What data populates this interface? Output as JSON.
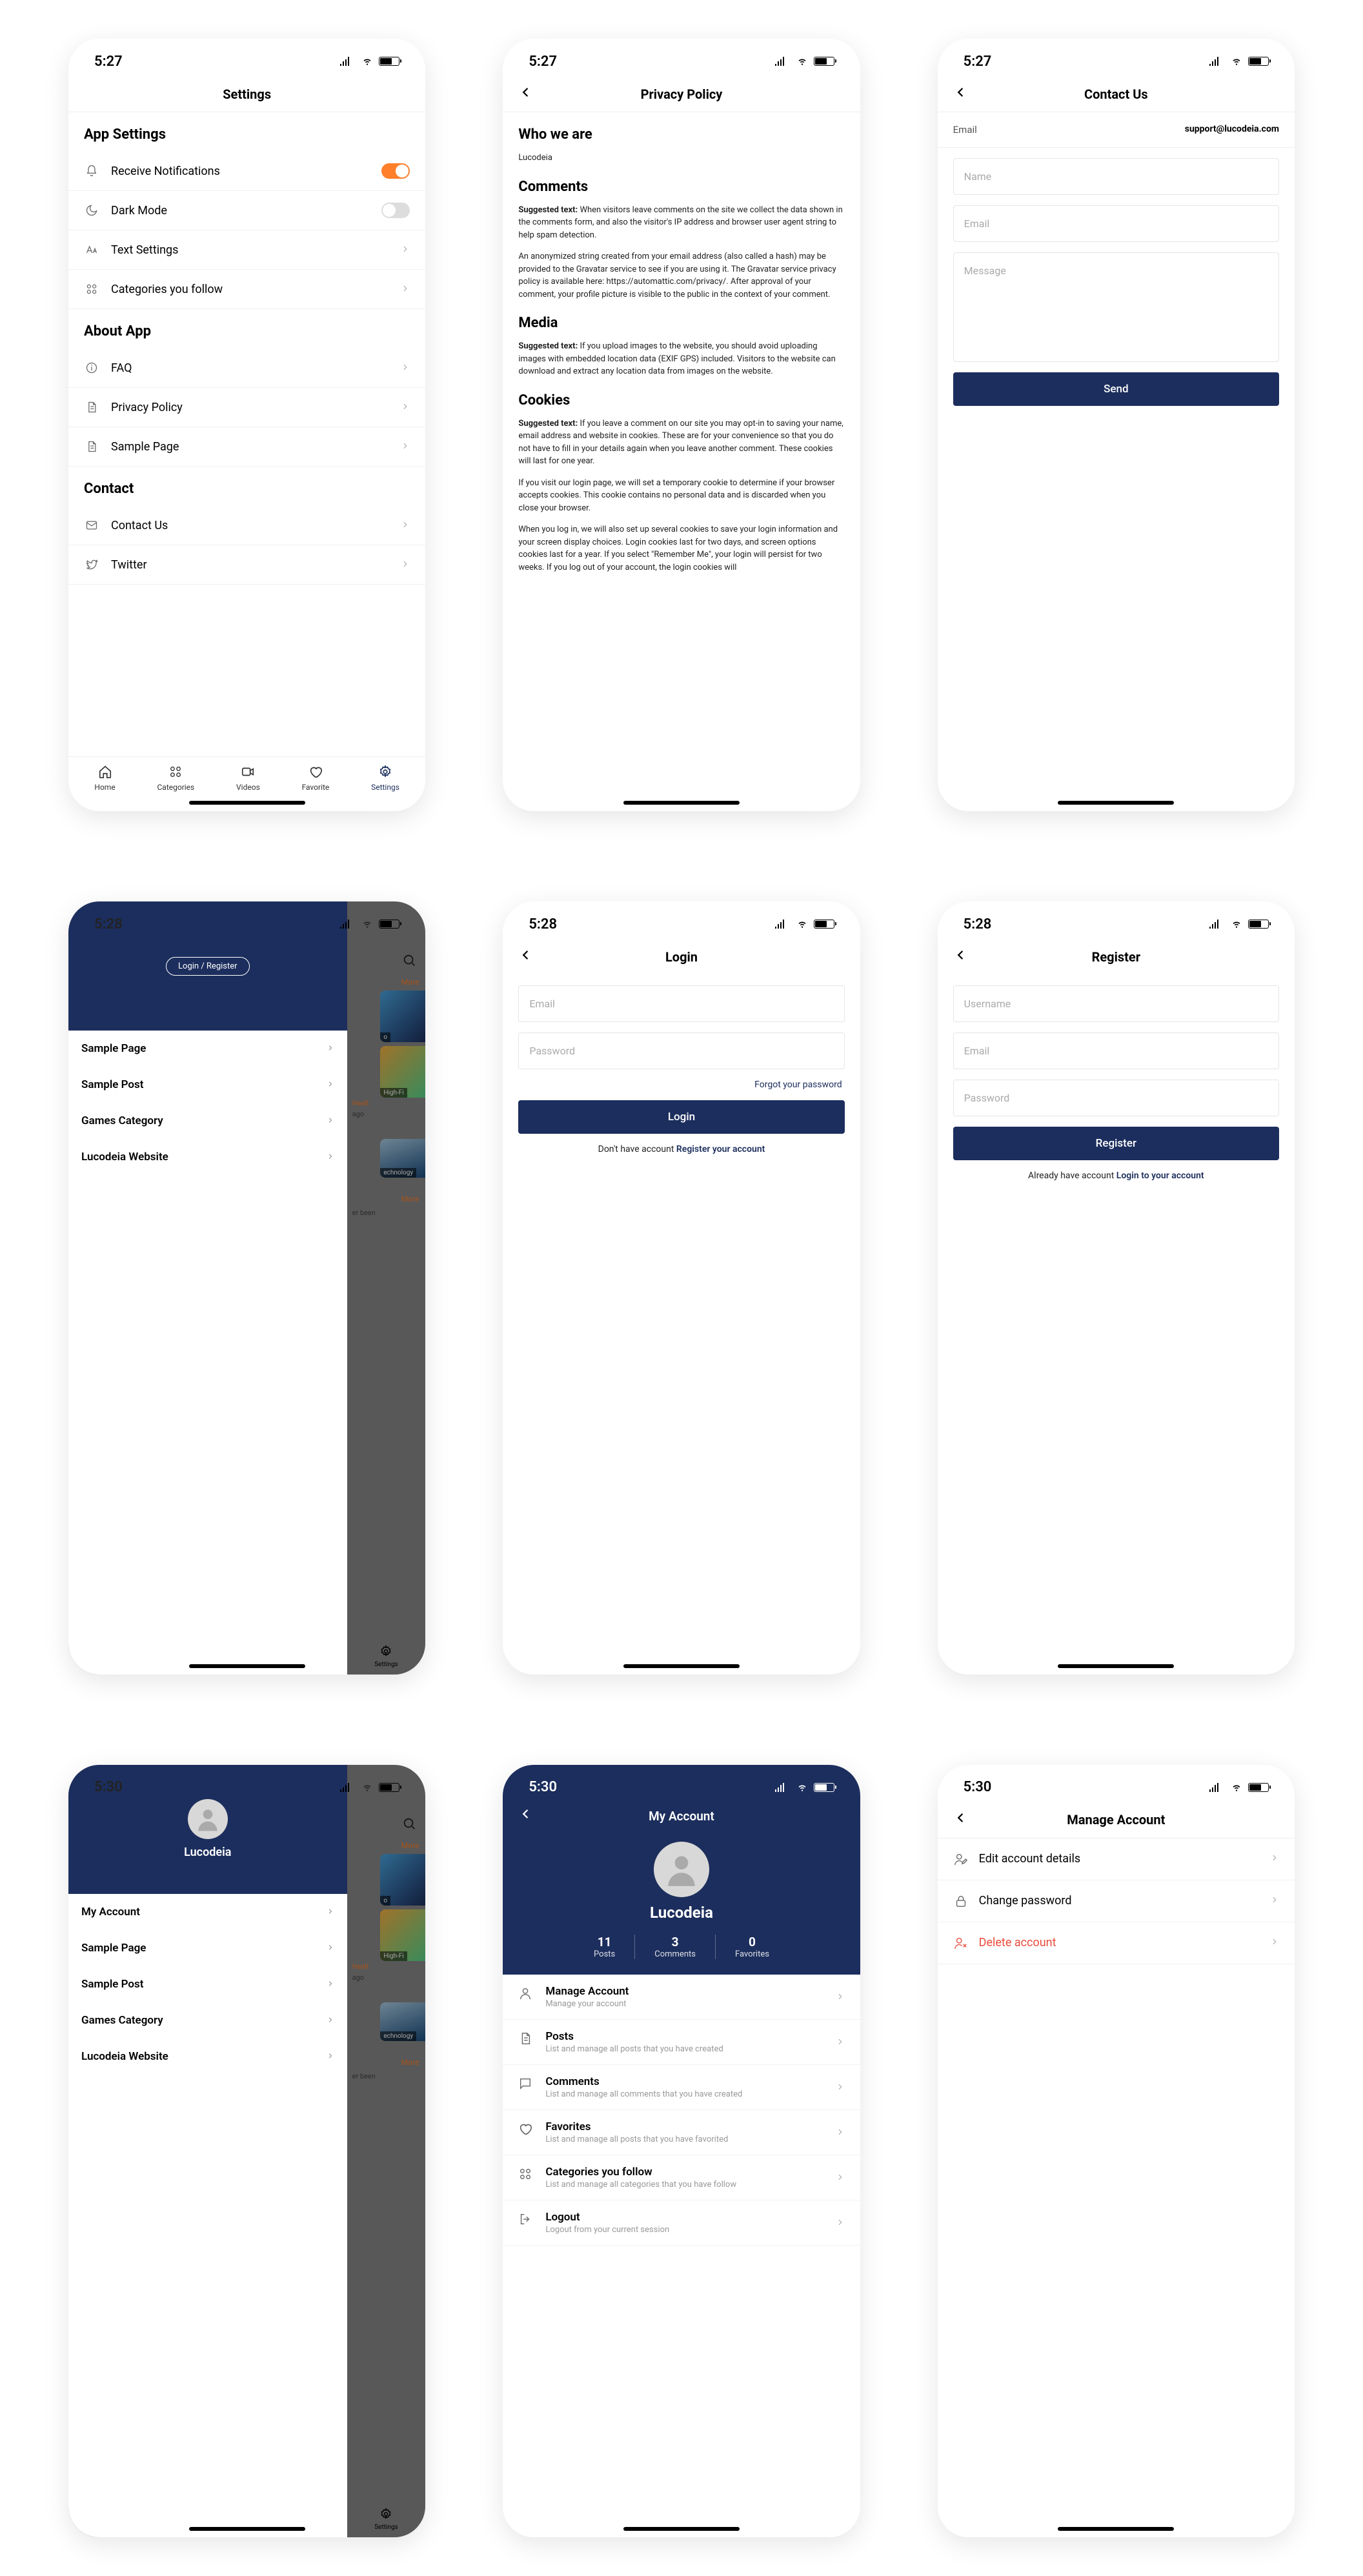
{
  "status_times": [
    "5:27",
    "5:27",
    "5:27",
    "5:28",
    "5:28",
    "5:28",
    "5:30",
    "5:30",
    "5:30"
  ],
  "screen1": {
    "title": "Settings",
    "sections": {
      "app": {
        "title": "App Settings",
        "items": [
          {
            "icon": "bell",
            "label": "Receive Notifications",
            "tail": "toggle-on"
          },
          {
            "icon": "moon",
            "label": "Dark Mode",
            "tail": "toggle-off"
          },
          {
            "icon": "text",
            "label": "Text Settings",
            "tail": "chevron"
          },
          {
            "icon": "grid",
            "label": "Categories you follow",
            "tail": "chevron"
          }
        ]
      },
      "about": {
        "title": "About App",
        "items": [
          {
            "icon": "info",
            "label": "FAQ",
            "tail": "chevron"
          },
          {
            "icon": "doc",
            "label": "Privacy Policy",
            "tail": "chevron"
          },
          {
            "icon": "doc",
            "label": "Sample Page",
            "tail": "chevron"
          }
        ]
      },
      "contact": {
        "title": "Contact",
        "items": [
          {
            "icon": "mail",
            "label": "Contact Us",
            "tail": "chevron"
          },
          {
            "icon": "twitter",
            "label": "Twitter",
            "tail": "chevron"
          }
        ]
      }
    },
    "tabs": [
      {
        "icon": "home",
        "label": "Home"
      },
      {
        "icon": "grid",
        "label": "Categories"
      },
      {
        "icon": "video",
        "label": "Videos"
      },
      {
        "icon": "heart",
        "label": "Favorite"
      },
      {
        "icon": "gear",
        "label": "Settings"
      }
    ]
  },
  "screen2": {
    "title": "Privacy Policy",
    "h_who": "Who we are",
    "p_who": "Lucodeia",
    "h_comments": "Comments",
    "p_c1_strong": "Suggested text:",
    "p_c1": " When visitors leave comments on the site we collect the data shown in the comments form, and also the visitor's IP address and browser user agent string to help spam detection.",
    "p_c2": "An anonymized string created from your email address (also called a hash) may be provided to the Gravatar service to see if you are using it. The Gravatar service privacy policy is available here: https://automattic.com/privacy/. After approval of your comment, your profile picture is visible to the public in the context of your comment.",
    "h_media": "Media",
    "p_m_strong": "Suggested text:",
    "p_m": " If you upload images to the website, you should avoid uploading images with embedded location data (EXIF GPS) included. Visitors to the website can download and extract any location data from images on the website.",
    "h_cookies": "Cookies",
    "p_ck1_strong": "Suggested text:",
    "p_ck1": " If you leave a comment on our site you may opt-in to saving your name, email address and website in cookies. These are for your convenience so that you do not have to fill in your details again when you leave another comment. These cookies will last for one year.",
    "p_ck2": "If you visit our login page, we will set a temporary cookie to determine if your browser accepts cookies. This cookie contains no personal data and is discarded when you close your browser.",
    "p_ck3": "When you log in, we will also set up several cookies to save your login information and your screen display choices. Login cookies last for two days, and screen options cookies last for a year. If you select \"Remember Me\", your login will persist for two weeks. If you log out of your account, the login cookies will"
  },
  "screen3": {
    "title": "Contact Us",
    "email_label": "Email",
    "email_value": "support@lucodeia.com",
    "ph_name": "Name",
    "ph_email": "Email",
    "ph_msg": "Message",
    "send": "Send"
  },
  "screen4": {
    "login_btn": "Login / Register",
    "items": [
      "Sample Page",
      "Sample Post",
      "Games Category",
      "Lucodeia Website"
    ],
    "behind": {
      "more": "More",
      "tag1": "High-Fi",
      "tag_health": "Healt",
      "tech": "echnology",
      "been": "er been",
      "settings": "Settings"
    }
  },
  "screen5": {
    "title": "Login",
    "ph_email": "Email",
    "ph_password": "Password",
    "forgot": "Forgot your password",
    "login_btn": "Login",
    "no_account": "Don't have account ",
    "register_link": "Register your account"
  },
  "screen6": {
    "title": "Register",
    "ph_user": "Username",
    "ph_email": "Email",
    "ph_password": "Password",
    "btn": "Register",
    "have_account": "Already have account ",
    "login_link": "Login to your account"
  },
  "screen7": {
    "name": "Lucodeia",
    "items": [
      "My Account",
      "Sample Page",
      "Sample Post",
      "Games Category",
      "Lucodeia Website"
    ],
    "behind": {
      "more": "More",
      "tag1": "High-Fi",
      "tag_health": "Healt",
      "tech": "echnology",
      "been": "er been",
      "settings": "Settings"
    }
  },
  "screen8": {
    "title": "My Account",
    "name": "Lucodeia",
    "stats": [
      {
        "num": "11",
        "lbl": "Posts"
      },
      {
        "num": "3",
        "lbl": "Comments"
      },
      {
        "num": "0",
        "lbl": "Favorites"
      }
    ],
    "rows": [
      {
        "icon": "user",
        "title": "Manage Account",
        "sub": "Manage your account"
      },
      {
        "icon": "doc",
        "title": "Posts",
        "sub": "List and manage all posts that you have created"
      },
      {
        "icon": "comment",
        "title": "Comments",
        "sub": "List and manage all comments that you have created"
      },
      {
        "icon": "heart",
        "title": "Favorites",
        "sub": "List and manage all posts that you have favorited"
      },
      {
        "icon": "grid",
        "title": "Categories you follow",
        "sub": "List and manage all categories that you have follow"
      },
      {
        "icon": "logout",
        "title": "Logout",
        "sub": "Logout from your current session"
      }
    ]
  },
  "screen9": {
    "title": "Manage Account",
    "rows": [
      {
        "icon": "user-edit",
        "label": "Edit account details",
        "danger": false
      },
      {
        "icon": "lock",
        "label": "Change password",
        "danger": false
      },
      {
        "icon": "user-x",
        "label": "Delete account",
        "danger": true
      }
    ]
  }
}
